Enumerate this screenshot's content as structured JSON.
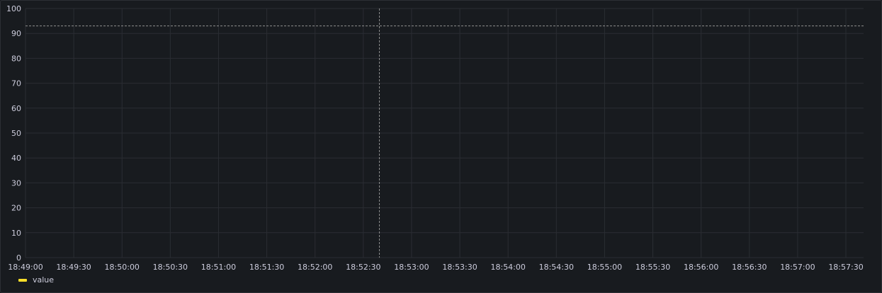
{
  "chart_data": {
    "type": "line",
    "y_ticks": [
      "0",
      "10",
      "20",
      "30",
      "40",
      "50",
      "60",
      "70",
      "80",
      "90",
      "100"
    ],
    "ylim": [
      0,
      100
    ],
    "x_ticks": [
      "18:49:00",
      "18:49:30",
      "18:50:00",
      "18:50:30",
      "18:51:00",
      "18:51:30",
      "18:52:00",
      "18:52:30",
      "18:53:00",
      "18:53:30",
      "18:54:00",
      "18:54:30",
      "18:55:00",
      "18:55:30",
      "18:56:00",
      "18:56:30",
      "18:57:00",
      "18:57:30"
    ],
    "xlim": [
      "18:49:00",
      "18:57:41"
    ],
    "grid": true,
    "crosshair": {
      "x": "18:52:40",
      "y": 93
    },
    "series": [
      {
        "name": "value",
        "color": "#fade2a",
        "values": []
      }
    ],
    "legend_position": "bottom-left"
  }
}
